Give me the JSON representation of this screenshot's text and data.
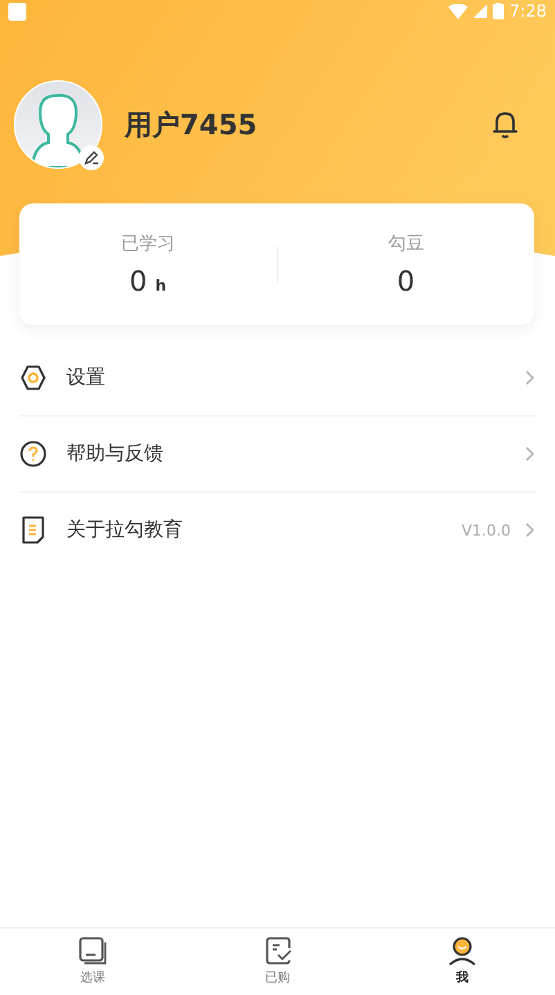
{
  "status_bar": {
    "time": "7:28"
  },
  "profile": {
    "username": "用户7455"
  },
  "stats": [
    {
      "label": "已学习",
      "value": "0",
      "unit": "h"
    },
    {
      "label": "勾豆",
      "value": "0"
    }
  ],
  "menu": [
    {
      "kind": "settings",
      "label": "设置"
    },
    {
      "kind": "help",
      "label": "帮助与反馈"
    },
    {
      "kind": "about",
      "label": "关于拉勾教育",
      "detail": "V1.0.0"
    }
  ],
  "tabs": [
    {
      "kind": "courses",
      "label": "选课",
      "selected": false
    },
    {
      "kind": "purchased",
      "label": "已购",
      "selected": false
    },
    {
      "kind": "me",
      "label": "我",
      "selected": true
    }
  ]
}
